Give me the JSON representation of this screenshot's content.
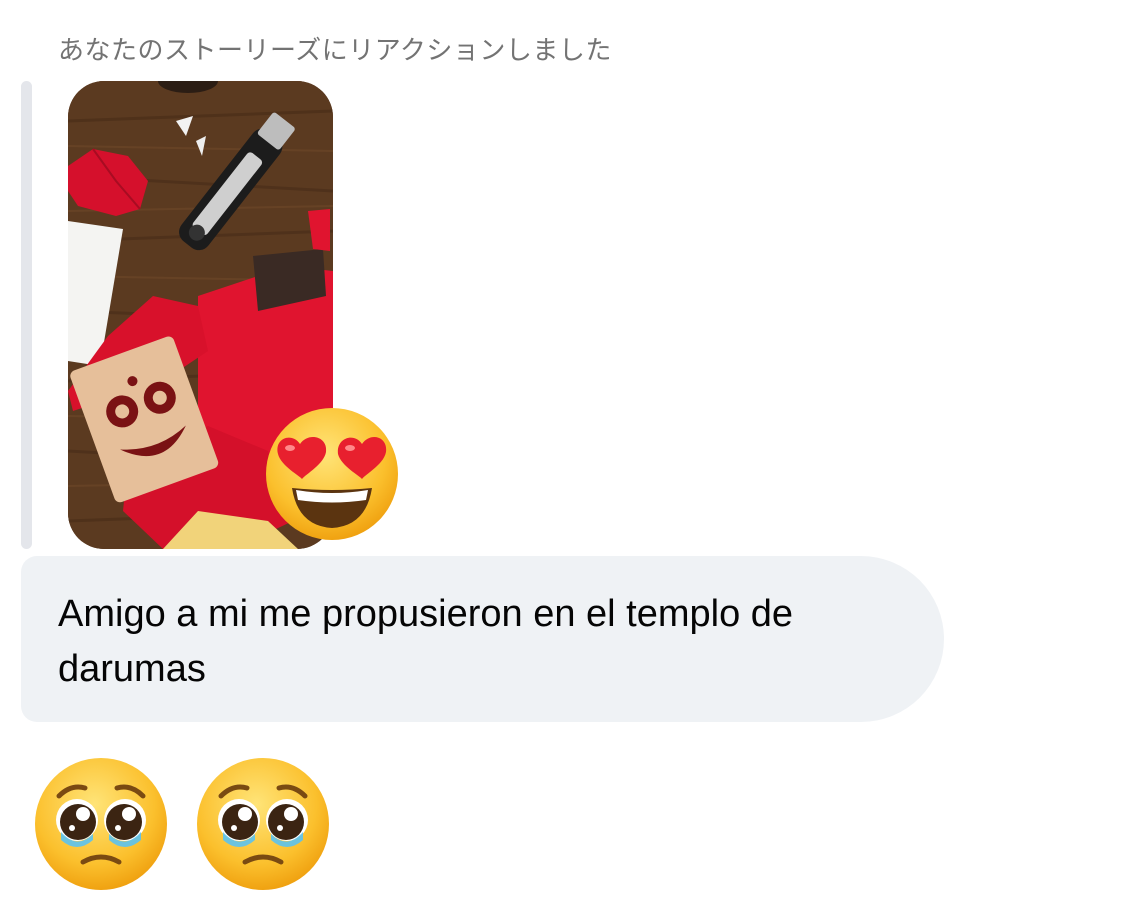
{
  "reaction_caption": "あなたのストーリーズにリアクションしました",
  "story": {
    "reaction": "heart-eyes-face"
  },
  "message": {
    "text": "Amigo a mi me propusieron en el templo de darumas"
  },
  "emoji_message": [
    "pleading-face",
    "pleading-face"
  ],
  "colors": {
    "bubble": "#eff2f5",
    "caption": "#737373",
    "reply_bar": "#e4e6eb",
    "text": "#050505"
  }
}
